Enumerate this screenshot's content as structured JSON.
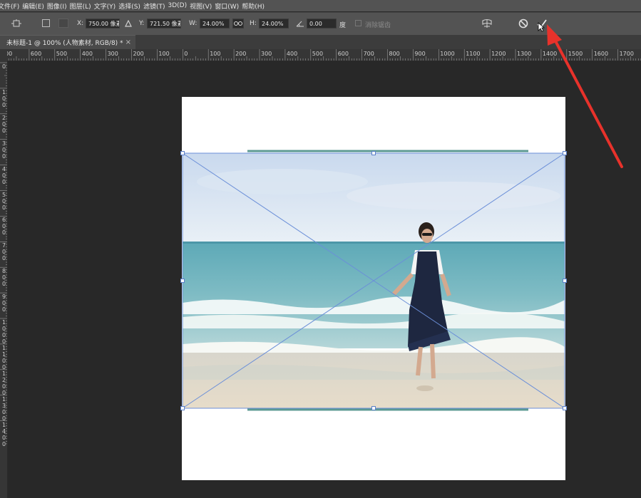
{
  "menu": [
    "文件(F)",
    "编辑(E)",
    "图像(I)",
    "图层(L)",
    "文字(Y)",
    "选择(S)",
    "滤镜(T)",
    "3D(D)",
    "视图(V)",
    "窗口(W)",
    "帮助(H)"
  ],
  "options": {
    "x_label": "X:",
    "x_value": "750.00 像素",
    "y_label": "Y:",
    "y_value": "721.50 像素",
    "w_label": "W:",
    "w_value": "24.00%",
    "h_label": "H:",
    "h_value": "24.00%",
    "angle_value": "0.00",
    "angle_unit": "度",
    "aa_label": "消除锯齿"
  },
  "document": {
    "tab_title": "未标题-1 @ 100% (人物素材, RGB/8) *",
    "close": "×"
  },
  "ruler_h": [
    "00",
    "600",
    "500",
    "400",
    "300",
    "200",
    "100",
    "0",
    "100",
    "200",
    "300",
    "400",
    "500",
    "600",
    "700",
    "800",
    "900",
    "1000",
    "1100",
    "1200",
    "1300",
    "1400",
    "1500",
    "1600",
    "1700"
  ],
  "ruler_v": [
    "0",
    "100",
    "200",
    "300",
    "400",
    "500",
    "600",
    "700",
    "800",
    "900",
    "1000",
    "1100",
    "1200",
    "1300",
    "1400"
  ],
  "colors": {
    "accent_guide": "#5c9a93",
    "arrow": "#e8322b",
    "transform_line": "#6b8fd8"
  }
}
